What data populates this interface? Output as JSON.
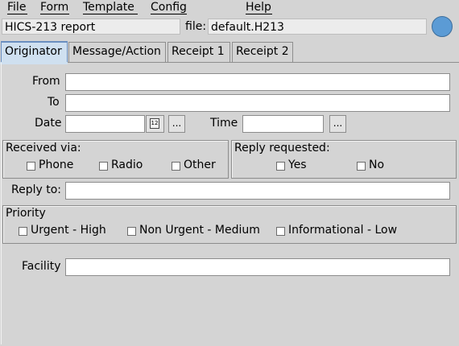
{
  "menu": {
    "file": "File",
    "form": "Form",
    "template": "Template",
    "config": "Config",
    "help": "Help"
  },
  "header": {
    "report_title": "HICS-213 report",
    "file_label": "file:",
    "file_name": "default.H213",
    "status_color": "#5b9bd5"
  },
  "tabs": [
    {
      "label": "Originator",
      "active": true
    },
    {
      "label": "Message/Action",
      "active": false
    },
    {
      "label": "Receipt 1",
      "active": false
    },
    {
      "label": "Receipt 2",
      "active": false
    }
  ],
  "form": {
    "from_label": "From",
    "from_value": "",
    "to_label": "To",
    "to_value": "",
    "date_label": "Date",
    "date_value": "",
    "calendar_icon_text": "12",
    "ellipsis": "...",
    "time_label": "Time",
    "time_value": "",
    "received_via": {
      "title": "Received via:",
      "options": [
        "Phone",
        "Radio",
        "Other"
      ]
    },
    "reply_requested": {
      "title": "Reply requested:",
      "options": [
        "Yes",
        "No"
      ]
    },
    "reply_to_label": "Reply to:",
    "reply_to_value": "",
    "priority": {
      "title": "Priority",
      "options": [
        "Urgent - High",
        "Non Urgent - Medium",
        "Informational - Low"
      ]
    },
    "facility_label": "Facility",
    "facility_value": ""
  }
}
